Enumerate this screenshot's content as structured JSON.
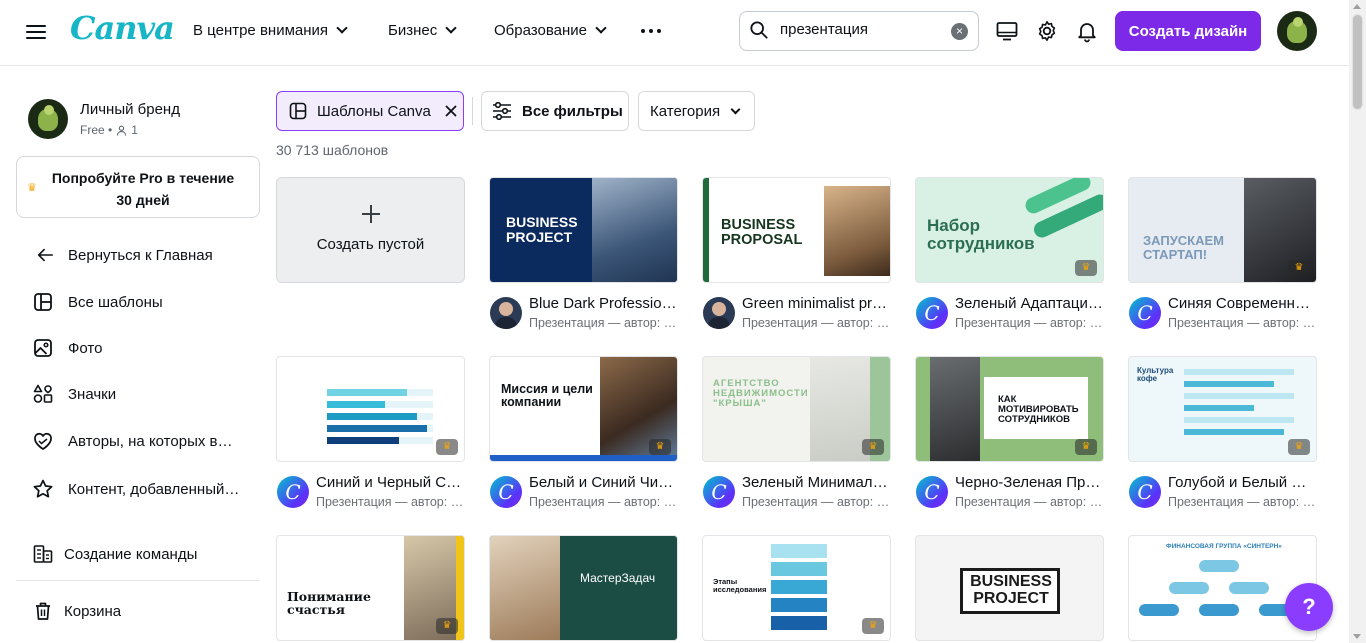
{
  "header": {
    "logo": "Canva",
    "nav": [
      {
        "label": "В центре внимания"
      },
      {
        "label": "Бизнес"
      },
      {
        "label": "Образование"
      }
    ],
    "search": {
      "value": "презентация",
      "placeholder": ""
    },
    "create_label": "Создать дизайн",
    "colors": {
      "accent": "#7d2ae8",
      "logo": "#16b6c6"
    }
  },
  "sidebar": {
    "profile": {
      "name": "Личный бренд",
      "plan": "Free •",
      "members": "1"
    },
    "pro": {
      "text": "Попробуйте Pro в течение 30 дней"
    },
    "items": [
      {
        "label": "Вернуться к Главная",
        "icon": "arrow-left-icon"
      },
      {
        "label": "Все шаблоны",
        "icon": "templates-icon"
      },
      {
        "label": "Фото",
        "icon": "photo-icon"
      },
      {
        "label": "Значки",
        "icon": "elements-icon"
      },
      {
        "label": "Авторы, на которых вы подписаны",
        "icon": "heart-icon"
      },
      {
        "label": "Контент, добавленный в избранное",
        "icon": "star-icon"
      },
      {
        "label": "Создание команды",
        "icon": "team-icon"
      },
      {
        "label": "Корзина",
        "icon": "trash-icon"
      }
    ]
  },
  "filters": {
    "chip_canva": "Шаблоны Canva",
    "all_filters": "Все фильтры",
    "category": "Категория",
    "count": "30 713 шаблонов"
  },
  "blank": {
    "label": "Создать пустой"
  },
  "cards": [
    {
      "title": "Blue Dark Professional Business Project Presentation",
      "sub": "Презентация — автор: Olivia Wilson",
      "thumb_text": "BUSINESS PROJECT",
      "avatar": "person"
    },
    {
      "title": "Green minimalist professional business proposal",
      "sub": "Презентация — автор: Olivia Wilson",
      "thumb_text": "BUSINESS PROPOSAL",
      "avatar": "person"
    },
    {
      "title": "Зеленый Адаптационный Набор сотрудников",
      "sub": "Презентация — автор: Canva",
      "thumb_text": "Набор сотрудников",
      "avatar": "canva"
    },
    {
      "title": "Синяя Современная Презентация Стартапа",
      "sub": "Презентация — автор: Canva",
      "thumb_text": "ЗАПУСКАЕМ СТАРТАП!",
      "avatar": "canva"
    },
    {
      "title": "Синий и Черный Современный Опрос",
      "sub": "Презентация — автор: Canva",
      "thumb_text": "",
      "avatar": "canva"
    },
    {
      "title": "Белый и Синий Чистый Миссия и цели",
      "sub": "Презентация — автор: Canva",
      "thumb_text": "Миссия и цели компании",
      "avatar": "canva"
    },
    {
      "title": "Зеленый Минималистичный Агентство Недвижимости",
      "sub": "Презентация — автор: Canva",
      "thumb_text": "АГЕНТСТВО НЕДВИЖИМОСТИ \"КРЫША\"",
      "avatar": "canva"
    },
    {
      "title": "Черно-Зеленая Презентация Мотивация",
      "sub": "Презентация — автор: Canva",
      "thumb_text": "КАК МОТИВИРОВАТЬ СОТРУДНИКОВ",
      "avatar": "canva"
    },
    {
      "title": "Голубой и Белый Современный Кофе",
      "sub": "Презентация — автор: Canva",
      "thumb_text": "Культура кофе",
      "avatar": "canva"
    },
    {
      "title": "",
      "sub": "",
      "thumb_text": "Понимание счастья",
      "avatar": ""
    },
    {
      "title": "",
      "sub": "",
      "thumb_text": "МастерЗадач",
      "avatar": ""
    },
    {
      "title": "",
      "sub": "",
      "thumb_text": "Этапы исследования",
      "avatar": ""
    },
    {
      "title": "",
      "sub": "",
      "thumb_text": "BUSINESS PROJECT",
      "avatar": ""
    },
    {
      "title": "",
      "sub": "",
      "thumb_text": "ФИНАНСОВАЯ ГРУППА «СИНТЕРН»",
      "avatar": ""
    }
  ],
  "help": {
    "label": "?"
  }
}
